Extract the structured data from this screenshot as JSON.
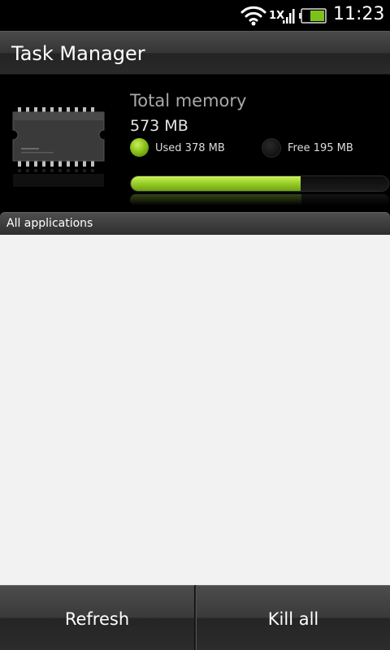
{
  "status_bar": {
    "network_label": "1X",
    "time": "11:23",
    "icons": [
      "wifi-icon",
      "signal-icon",
      "battery-icon"
    ]
  },
  "header": {
    "title": "Task Manager"
  },
  "memory": {
    "title": "Total memory",
    "total": "573 MB",
    "used_label": "Used 378 MB",
    "free_label": "Free 195 MB",
    "used_fraction": 0.66,
    "used_color": "#9bd12a",
    "free_color": "#151515"
  },
  "section": {
    "label": "All applications"
  },
  "buttons": {
    "refresh": "Refresh",
    "kill_all": "Kill all"
  },
  "colors": {
    "accent": "#9bd12a",
    "list_background": "#f2f2f2"
  }
}
